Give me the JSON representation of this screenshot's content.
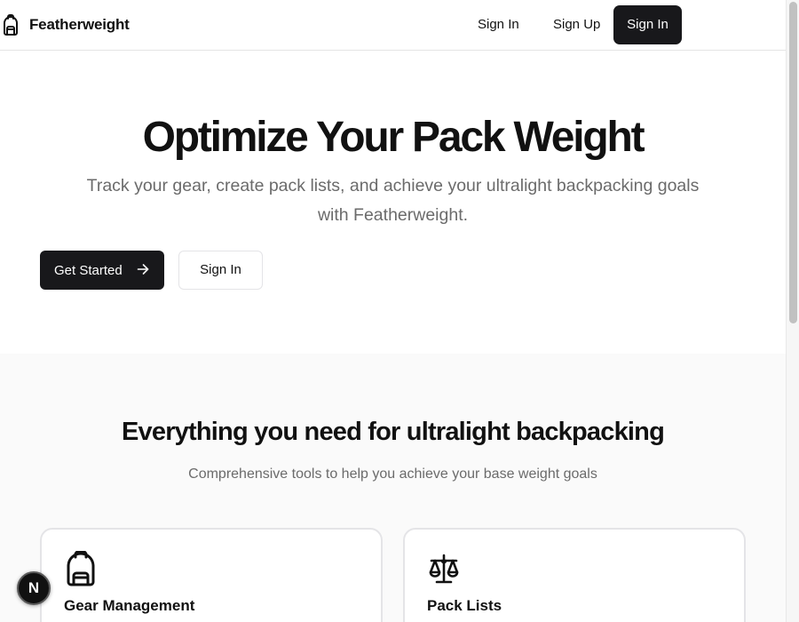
{
  "header": {
    "brand_name": "Featherweight",
    "brand_icon": "backpack-icon",
    "nav": {
      "sign_in_link": "Sign In",
      "sign_up_link": "Sign Up",
      "sign_in_button": "Sign In"
    }
  },
  "hero": {
    "title": "Optimize Your Pack Weight",
    "subtitle": "Track your gear, create pack lists, and achieve your ultralight backpacking goals with Featherweight.",
    "get_started_label": "Get Started",
    "get_started_icon": "arrow-right-icon",
    "sign_in_label": "Sign In"
  },
  "features": {
    "title": "Everything you need for ultralight backpacking",
    "subtitle": "Comprehensive tools to help you achieve your base weight goals",
    "cards": [
      {
        "icon": "backpack-icon",
        "title": "Gear Management"
      },
      {
        "icon": "scale-icon",
        "title": "Pack Lists"
      }
    ]
  },
  "dev_badge": {
    "label": "N"
  },
  "colors": {
    "primary": "#18181b",
    "text": "#111111",
    "muted_text": "#6b6b6b",
    "border": "#e4e4e7",
    "section_bg": "#fafafa"
  }
}
